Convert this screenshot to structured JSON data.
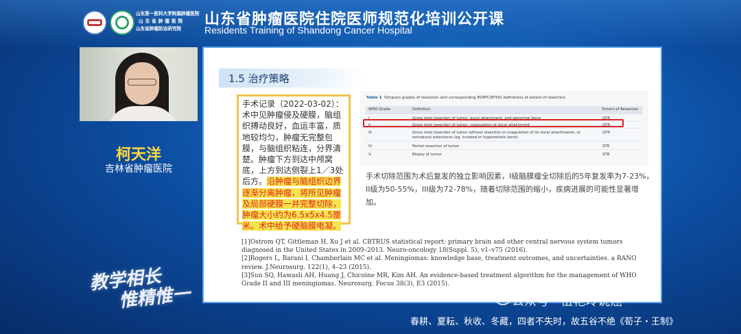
{
  "header": {
    "institution_lines": [
      "山东第一医科大学附属肿瘤医院",
      "山东省肿瘤医院",
      "山东省肿瘤防治研究院"
    ],
    "title_cn": "山东省肿瘤医院住院医师规范化培训公开课",
    "title_en": "Residents Training of Shandong Cancer Hospital"
  },
  "speaker": {
    "name": "柯天洋",
    "organization": "吉林省肿瘤医院"
  },
  "motto": {
    "line1": "教学相长",
    "line2": "惟精惟一"
  },
  "slide": {
    "section_title": "1.5 治疗策略",
    "surgery_note": {
      "normal": "手术记录（2022-03-02）：术中见肿瘤侵及硬膜，脑组织搏动良好，血运丰富，质地较均匀，肿瘤无完整包膜，与脑组织粘连，分界清楚。肿瘤下方到达中颅窝底，上方到达侧裂上1／3处后方。",
      "highlight": "沿肿瘤与脑组织边界逐渐分离肿瘤，将所见肿瘤及局部硬膜一并完整切除，肿瘤大小约为6.5x5x4.5厘米。术中给予硬脑膜电凝。"
    },
    "table": {
      "caption_label": "Table 1",
      "caption": "Simpson grades of resection and corresponding EORTC/RTOG definitions of extent of resection",
      "headers": [
        "WHO Grade",
        "Definition",
        "Extent of Resection"
      ],
      "rows": [
        [
          "I",
          "Gross total resection of tumor, dural attachment, and abnormal bone",
          "GTR"
        ],
        [
          "II",
          "Gross total resection of tumor, coagulation of dural attachment",
          "GTR"
        ],
        [
          "III",
          "Gross total resection of tumor without resection or coagulation of its dural attachments, or extradural extensions (eg, invaded or hyperostotic bone)",
          "GTR"
        ],
        [
          "IV",
          "Partial resection of tumor",
          "STR"
        ],
        [
          "V",
          "Biopsy of tumor",
          "STR"
        ]
      ]
    },
    "body_text": "手术切除范围为术后复发的独立影响因素，I级脑膜瘤全切除后的5年复发率为7-23%，II级为50-55%，III级为72-78%，随着切除范围的缩小，疾病进展的可能性显著增加。",
    "references": [
      "[1]Ostrom QT, Gittleman H, Xu J et al. CBTRUS statistical report: primary brain and other central nervous system tumors diagnosed in the United States in 2009–2013. Neuro-oncology 18(Suppl. 5), v1–v75 (2016).",
      "[2]Rogers L, Barani I, Chamberlain MC et al. Meningiomas: knowledge base, treatment outcomes, and uncertainties. a RANO review. J.Neurosurg. 122(1), 4–23 (2015).",
      "[3]Sun SQ, Hawasli AH, Huang J, Chicoine MR, Kim AH. An evidence-based treatment algorithm for the management of WHO Grade II and III meningiomas. Neurosurg. Focus 38(3), E3 (2015)."
    ]
  },
  "watermark": "公众号 · 伍艳玲说癌",
  "footer_quote": "春耕、夏耘、秋收、冬藏，四者不失时，故五谷不绝《荀子・王制》",
  "colors": {
    "accent_blue": "#1b7fd6",
    "name_yellow": "#ffd83a",
    "highlight_red": "#e0261b",
    "highlight_yellow": "#f7e34d"
  }
}
